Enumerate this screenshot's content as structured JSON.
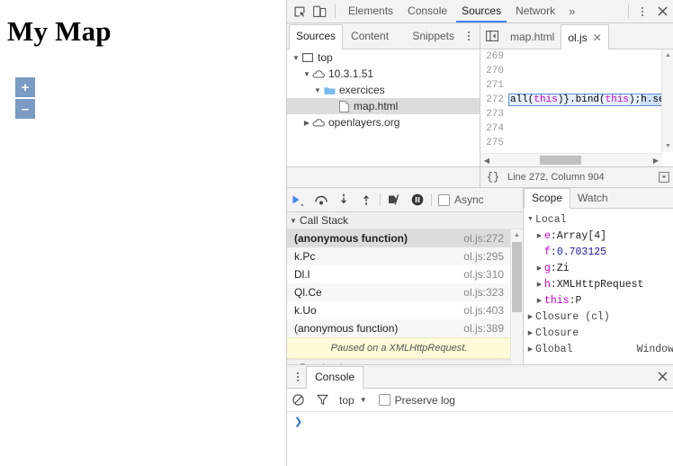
{
  "page": {
    "title": "My Map",
    "zoom_in_label": "+",
    "zoom_out_label": "–"
  },
  "devtools": {
    "toolbar": {
      "inspect_icon": "inspect-element-icon",
      "device_icon": "device-toolbar-icon",
      "tabs": [
        {
          "label": "Elements",
          "selected": false
        },
        {
          "label": "Console",
          "selected": false
        },
        {
          "label": "Sources",
          "selected": true
        },
        {
          "label": "Network",
          "selected": false
        }
      ],
      "more_label": "»",
      "menu_icon": "kebab-menu-icon",
      "close_label": "✕"
    },
    "navigator": {
      "tabs": [
        {
          "label": "Sources",
          "selected": true
        },
        {
          "label": "Content ...",
          "selected": false
        },
        {
          "label": "Snippets",
          "selected": false
        }
      ],
      "menu_icon": "kebab-menu-icon",
      "tree": [
        {
          "label": "top",
          "icon": "frame-icon",
          "depth": 0,
          "twisty": "▼",
          "selected": false
        },
        {
          "label": "10.3.1.51",
          "icon": "cloud-icon",
          "depth": 1,
          "twisty": "▼",
          "selected": false
        },
        {
          "label": "exercices",
          "icon": "folder-icon",
          "depth": 2,
          "twisty": "▼",
          "selected": false
        },
        {
          "label": "map.html",
          "icon": "file-icon",
          "depth": 3,
          "twisty": "",
          "selected": true
        },
        {
          "label": "openlayers.org",
          "icon": "cloud-icon",
          "depth": 1,
          "twisty": "▶",
          "selected": false
        }
      ]
    },
    "editor": {
      "collapse_icon": "collapse-sidebar-icon",
      "tabs": [
        {
          "label": "map.html",
          "selected": false,
          "closable": false
        },
        {
          "label": "ol.js",
          "selected": true,
          "closable": true,
          "close_label": "✕"
        }
      ],
      "lines": [
        {
          "num": "269",
          "text": "",
          "current": false
        },
        {
          "num": "270",
          "text": "",
          "current": false
        },
        {
          "num": "271",
          "text": "",
          "current": false
        },
        {
          "num": "272",
          "text": "all(this)}.bind(this);h.se",
          "current": true
        },
        {
          "num": "273",
          "text": "",
          "current": false
        },
        {
          "num": "274",
          "text": "",
          "current": false
        },
        {
          "num": "275",
          "text": "",
          "current": false
        }
      ],
      "code_segments": [
        {
          "t": "all(",
          "cls": ""
        },
        {
          "t": "this",
          "cls": "kw-this"
        },
        {
          "t": ")}.bind(",
          "cls": ""
        },
        {
          "t": "this",
          "cls": "kw-this"
        },
        {
          "t": ");",
          "cls": ""
        },
        {
          "t": "h.se",
          "cls": "sel-hl"
        }
      ]
    },
    "status": {
      "format_icon": "{}",
      "cursor_position": "Line 272, Column 904",
      "right_icon": "editor-settings-icon"
    },
    "debugger": {
      "controls": [
        {
          "name": "resume-script-execution",
          "icon": "resume-icon"
        },
        {
          "name": "step-over-next-function-call",
          "icon": "step-over-icon"
        },
        {
          "name": "step-into-next-function-call",
          "icon": "step-into-icon"
        },
        {
          "name": "step-out-of-current-function",
          "icon": "step-out-icon"
        },
        {
          "name": "deactivate-breakpoints",
          "icon": "deactivate-breakpoints-icon"
        },
        {
          "name": "pause-on-exceptions",
          "icon": "pause-on-exceptions-icon"
        }
      ],
      "async_label": "Async",
      "async_checked": false,
      "call_stack": {
        "title": "Call Stack",
        "twisty": "▼",
        "rows": [
          {
            "name": "(anonymous function)",
            "location": "ol.js:272",
            "selected": true
          },
          {
            "name": "k.Pc",
            "location": "ol.js:295",
            "selected": false
          },
          {
            "name": "Dl.l",
            "location": "ol.js:310",
            "selected": false
          },
          {
            "name": "Ql.Ce",
            "location": "ol.js:323",
            "selected": false
          },
          {
            "name": "k.Uo",
            "location": "ol.js:403",
            "selected": false
          },
          {
            "name": "(anonymous function)",
            "location": "ol.js:389",
            "selected": false
          }
        ]
      },
      "paused_message": "Paused on a XMLHttpRequest.",
      "breakpoints": {
        "title": "Breakpoints",
        "twisty": "▼",
        "caret": "▼"
      }
    },
    "scope": {
      "tabs": [
        {
          "label": "Scope",
          "selected": true
        },
        {
          "label": "Watch",
          "selected": false
        }
      ],
      "rows": [
        {
          "twisty": "▼",
          "depth": 0,
          "prop": "Local",
          "sep": "",
          "value": "",
          "kind": "plain"
        },
        {
          "twisty": "▶",
          "depth": 1,
          "prop": "e",
          "sep": ": ",
          "value": "Array[4]",
          "kind": "obj"
        },
        {
          "twisty": "",
          "depth": 1,
          "prop": "f",
          "sep": ": ",
          "value": "0.703125",
          "kind": "num"
        },
        {
          "twisty": "▶",
          "depth": 1,
          "prop": "g",
          "sep": ": ",
          "value": "Zi",
          "kind": "obj"
        },
        {
          "twisty": "▶",
          "depth": 1,
          "prop": "h",
          "sep": ": ",
          "value": "XMLHttpRequest",
          "kind": "obj"
        },
        {
          "twisty": "▶",
          "depth": 1,
          "prop": "this",
          "sep": ": ",
          "value": "P",
          "kind": "obj"
        },
        {
          "twisty": "▶",
          "depth": 0,
          "prop": "Closure (cl)",
          "sep": "",
          "value": "",
          "kind": "plain"
        },
        {
          "twisty": "▶",
          "depth": 0,
          "prop": "Closure",
          "sep": "",
          "value": "",
          "kind": "plain"
        },
        {
          "twisty": "▶",
          "depth": 0,
          "prop": "Global",
          "sep": "",
          "value": "Window",
          "kind": "global"
        }
      ]
    },
    "drawer": {
      "menu_icon": "kebab-menu-icon",
      "tab_label": "Console",
      "close_label": "✕",
      "clear_icon": "clear-console-icon",
      "filter_icon": "filter-icon",
      "context_label": "top",
      "context_caret": "▼",
      "preserve_log_label": "Preserve log",
      "preserve_log_checked": false,
      "prompt": "❯"
    }
  },
  "colors": {
    "accent_blue": "#4285f4",
    "ol_button": "#7b9ac4",
    "paused_banner": "#fffbd8",
    "selection_blue": "#cfe0f7",
    "property_magenta": "#cc00cc",
    "number_blue": "#1a1aa6"
  }
}
